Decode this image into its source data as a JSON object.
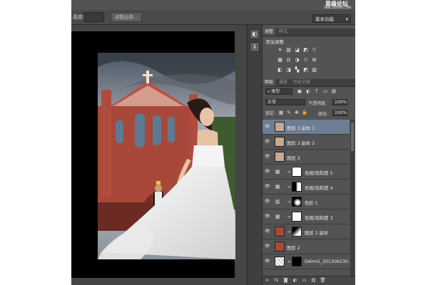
{
  "options_bar": {
    "label": "晶度:",
    "button": "调整边缘...",
    "workspace": "基本功能"
  },
  "watermark": {
    "main": "思缘论坛",
    "sub": "BBS.16XX8.COM"
  },
  "dock": {
    "buttons": [
      {
        "icon": "adjust-icon",
        "glyph": "◐"
      },
      {
        "icon": "info-icon",
        "glyph": "ℹ"
      }
    ]
  },
  "adjustments_panel": {
    "tabs": [
      "调整",
      "样式"
    ],
    "title": "添加调整",
    "icon_rows": [
      [
        "☀",
        "▥",
        "◪",
        "◩",
        "▽"
      ],
      [
        "▦",
        "⚖",
        "◑",
        "♲",
        "⊞"
      ],
      [
        "◧",
        "◨",
        "▚",
        "◩",
        "▧"
      ]
    ]
  },
  "layers_panel": {
    "tabs": [
      "图层",
      "通道",
      "历史记录"
    ],
    "filter_kind": "类型",
    "blend_mode": "正常",
    "opacity_label": "不透明度:",
    "opacity_value": "100%",
    "lock_label": "锁定:",
    "fill_label": "填充:",
    "fill_value": "100%",
    "layers": [
      {
        "name": "图层 3 副本 3",
        "kind": "pixel",
        "selected": true
      },
      {
        "name": "图层 3 副本 2",
        "kind": "pixel",
        "selected": false
      },
      {
        "name": "图层 3",
        "kind": "pixel",
        "selected": false
      },
      {
        "name": "色相/饱和度 5",
        "kind": "adjust",
        "selected": false
      },
      {
        "name": "色相/饱和度 4",
        "kind": "adjust",
        "selected": false
      },
      {
        "name": "色阶 1",
        "kind": "adjust",
        "selected": false
      },
      {
        "name": "色相/饱和度 3",
        "kind": "adjust",
        "selected": false
      },
      {
        "name": "图层 2 副本",
        "kind": "pixel",
        "selected": false
      },
      {
        "name": "图层 2",
        "kind": "pixel",
        "selected": false
      },
      {
        "name": "DAimG_201306230...",
        "kind": "smart",
        "selected": false
      }
    ],
    "footer_icons": [
      "∞",
      "fx",
      "◙",
      "◐",
      "▭",
      "▤",
      "🗑"
    ]
  }
}
